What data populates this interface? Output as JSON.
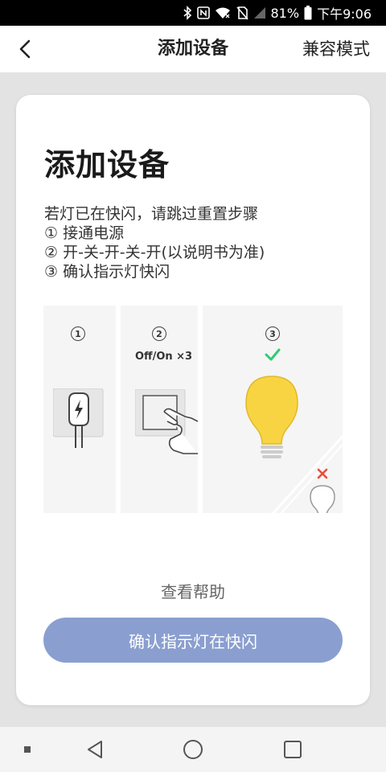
{
  "status_bar": {
    "battery_percent": "81%",
    "time": "下午9:06",
    "icons": [
      "bluetooth-icon",
      "nfc-icon",
      "wifi-icon",
      "no-sim-icon",
      "signal-icon",
      "battery-icon"
    ]
  },
  "header": {
    "back_icon": "chevron-left-icon",
    "title": "添加设备",
    "compat_mode": "兼容模式"
  },
  "card": {
    "title": "添加设备",
    "instructions": [
      "若灯已在快闪，请跳过重置步骤",
      "① 接通电源",
      "② 开-关-开-关-开(以说明书为准)",
      "③ 确认指示灯快闪"
    ],
    "steps": [
      {
        "number": "1",
        "caption": "",
        "icon": "power-plug-icon"
      },
      {
        "number": "2",
        "caption": "Off/On ×3",
        "icon": "switch-press-icon"
      },
      {
        "number": "3",
        "caption": "",
        "icon": "lightbulb-on-icon"
      }
    ],
    "help_link": "查看帮助",
    "confirm_button": "确认指示灯在快闪"
  },
  "colors": {
    "accent": "#8a9fd0",
    "check": "#2ecc71",
    "cross": "#e74c3c",
    "bulb": "#f9d442"
  },
  "system_nav": {
    "icons": [
      "dot-icon",
      "back-triangle-icon",
      "home-circle-icon",
      "recents-square-icon"
    ]
  }
}
